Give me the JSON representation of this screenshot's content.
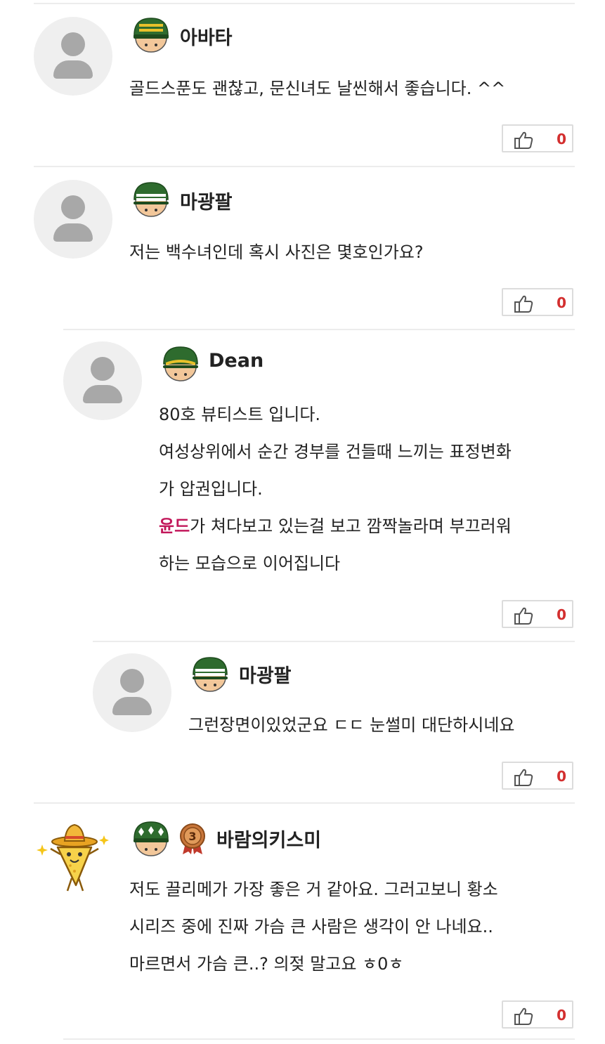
{
  "comments": [
    {
      "nick": "아바타",
      "lines": [
        "골드스푼도 괜찮고,  문신녀도 날씬해서 좋습니다. ^^"
      ],
      "likes": "0",
      "rank_icon": "helmet-gold-stripe-icon"
    },
    {
      "nick": "마광팔",
      "lines": [
        "저는 백수녀인데 혹시 사진은 몇호인가요?"
      ],
      "likes": "0",
      "rank_icon": "helmet-white-stripe-icon"
    },
    {
      "nick": "Dean",
      "lines": [
        "80호 뷰티스트 입니다.",
        "여성상위에서 순간 경부를 건들때 느끼는 표정변화",
        "가 압권입니다."
      ],
      "mention": "윤드",
      "mention_rest": "가 쳐다보고 있는걸 보고 깜짝놀라며 부끄러워",
      "last_line": "하는 모습으로 이어집니다",
      "likes": "0",
      "rank_icon": "helmet-gold-band-icon"
    },
    {
      "nick": "마광팔",
      "lines": [
        "그런장면이있었군요 ㄷㄷ 눈썰미 대단하시네요"
      ],
      "likes": "0",
      "rank_icon": "helmet-white-stripe-icon"
    },
    {
      "nick": "바람의키스미",
      "lines": [
        "저도 끌리메가 가장 좋은 거 같아요. 그러고보니 황소",
        "시리즈 중에 진짜 가슴 큰 사람은 생각이 안 나네요..",
        "마르면서 가슴 큰..? 의젖 말고요 ㅎ0ㅎ"
      ],
      "likes": "0",
      "rank_icon": "helmet-three-diamonds-icon",
      "medal_number": "3"
    }
  ],
  "colors": {
    "mention": "#c2185b",
    "like_count": "#d32f2f",
    "helmet": "#2e6b2e",
    "avatar_bg": "#efefef"
  }
}
